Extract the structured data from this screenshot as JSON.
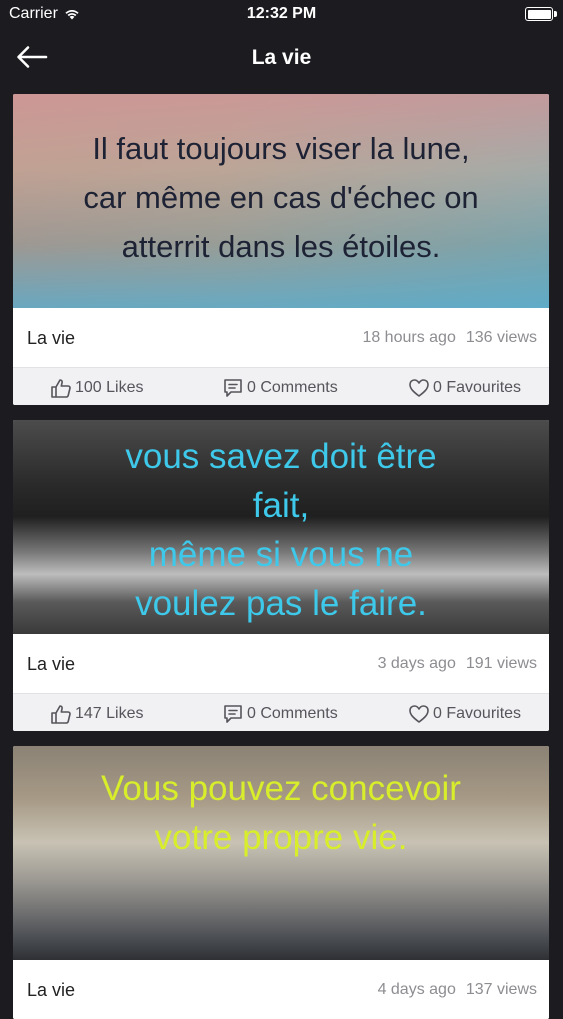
{
  "status_bar": {
    "carrier": "Carrier",
    "time": "12:32 PM"
  },
  "nav": {
    "title": "La vie"
  },
  "posts": [
    {
      "quote": "Il faut toujours viser la lune,\ncar même en cas d'échec on\natterrit dans les étoiles.",
      "category": "La vie",
      "time_ago": "18 hours ago",
      "views": "136 views",
      "likes": "100 Likes",
      "comments": "0 Comments",
      "favourites": "0 Favourites"
    },
    {
      "quote": "vous savez doit être\nfait,\nmême si vous ne\nvoulez pas le faire.",
      "category": "La vie",
      "time_ago": "3 days ago",
      "views": "191 views",
      "likes": "147 Likes",
      "comments": "0 Comments",
      "favourites": "0 Favourites"
    },
    {
      "quote": "Vous pouvez concevoir\nvotre propre vie.",
      "category": "La vie",
      "time_ago": "4 days ago",
      "views": "137 views"
    }
  ]
}
